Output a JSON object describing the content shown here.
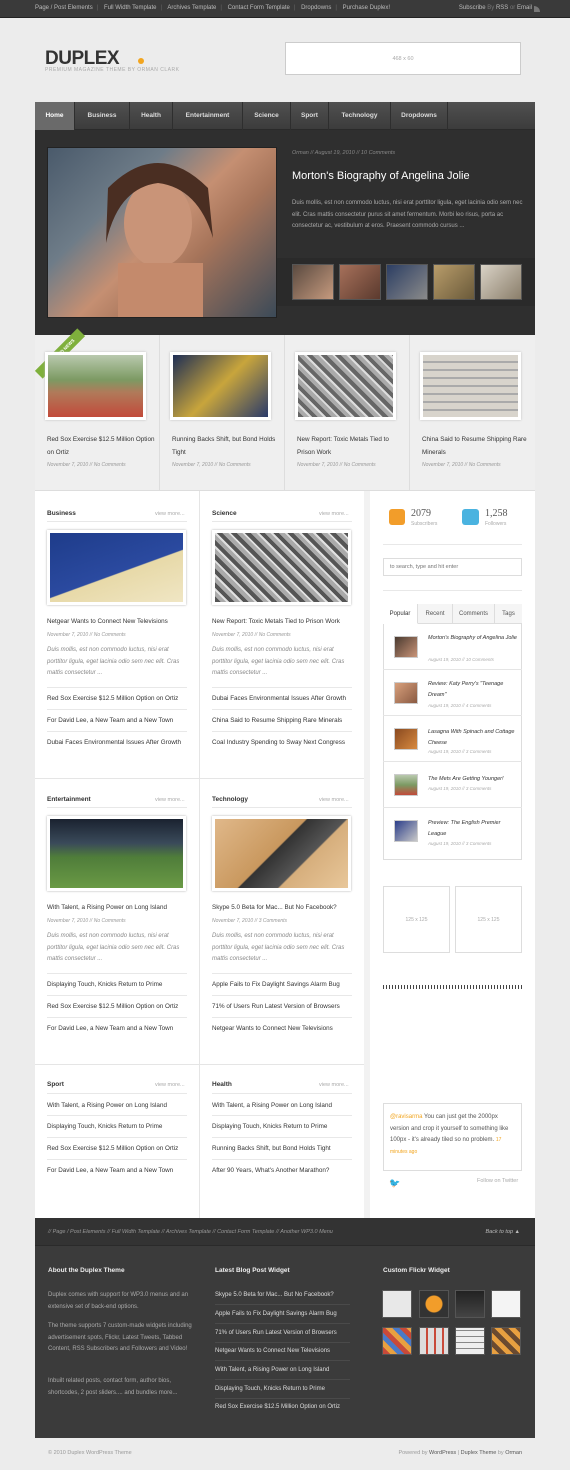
{
  "topbar": {
    "links": [
      "Page / Post Elements",
      "Full Width Template",
      "Archives Template",
      "Contact Form Template",
      "Dropdowns",
      "Purchase Duplex!"
    ],
    "subscribe": "Subscribe",
    "by": "By",
    "rss": "RSS",
    "or": "or",
    "email": "Email"
  },
  "header": {
    "logo": "DUPLEX",
    "tagline": "PREMIUM MAGAZINE THEME BY ORMAN CLARK",
    "ad": "468 x 60"
  },
  "nav": [
    "Home",
    "Business",
    "Health",
    "Entertainment",
    "Science",
    "Sport",
    "Technology",
    "Dropdowns"
  ],
  "feature": {
    "author": "Orman",
    "sep1": "//",
    "date": "August 19, 2010",
    "sep2": "//",
    "comments": "10 Comments",
    "title": "Morton's Biography of Angelina Jolie",
    "desc": "Duis mollis, est non commodo luctus, nisi erat porttitor ligula, eget lacinia odio sem nec elit. Cras mattis consectetur purus sit amet fermentum. Morbi leo risus, porta ac consectetur ac, vestibulum at eros. Praesent commodo cursus ..."
  },
  "ribbon": "FEATURED NEWS",
  "featured": [
    {
      "title": "Red Sox Exercise $12.5 Million Option on Ortiz",
      "date": "November 7, 2010",
      "comments": "No Comments"
    },
    {
      "title": "Running Backs Shift, but Bond Holds Tight",
      "date": "November 7, 2010",
      "comments": "No Comments"
    },
    {
      "title": "New Report: Toxic Metals Tied to Prison Work",
      "date": "November 7, 2010",
      "comments": "No Comments"
    },
    {
      "title": "China Said to Resume Shipping Rare Minerals",
      "date": "November 7, 2010",
      "comments": "No Comments"
    }
  ],
  "sep": "//",
  "viewmore": "view more...",
  "sections": {
    "business": {
      "head": "Business",
      "title": "Netgear Wants to Connect New Televisions",
      "date": "November 7, 2010",
      "comments": "No Comments",
      "excerpt": "Duis mollis, est non commodo luctus, nisi erat porttitor ligula, eget lacinia odio sem nec elit. Cras mattis consectetur ...",
      "links": [
        "Red Sox Exercise $12.5 Million Option on Ortiz",
        "For David Lee, a New Team and a New Town",
        "Dubai Faces Environmental Issues After Growth"
      ]
    },
    "science": {
      "head": "Science",
      "title": "New Report: Toxic Metals Tied to Prison Work",
      "date": "November 7, 2010",
      "comments": "No Comments",
      "excerpt": "Duis mollis, est non commodo luctus, nisi erat porttitor ligula, eget lacinia odio sem nec elit. Cras mattis consectetur ...",
      "links": [
        "Dubai Faces Environmental Issues After Growth",
        "China Said to Resume Shipping Rare Minerals",
        "Coal Industry Spending to Sway Next Congress"
      ]
    },
    "entertainment": {
      "head": "Entertainment",
      "title": "With Talent, a Rising Power on Long Island",
      "date": "November 7, 2010",
      "comments": "No Comments",
      "excerpt": "Duis mollis, est non commodo luctus, nisi erat porttitor ligula, eget lacinia odio sem nec elit. Cras mattis consectetur ...",
      "links": [
        "Displaying Touch, Knicks Return to Prime",
        "Red Sox Exercise $12.5 Million Option on Ortiz",
        "For David Lee, a New Team and a New Town"
      ]
    },
    "technology": {
      "head": "Technology",
      "title": "Skype 5.0 Beta for Mac... But No Facebook?",
      "date": "November 7, 2010",
      "comments": "3 Comments",
      "excerpt": "Duis mollis, est non commodo luctus, nisi erat porttitor ligula, eget lacinia odio sem nec elit. Cras mattis consectetur ...",
      "links": [
        "Apple Fails to Fix Daylight Savings Alarm Bug",
        "71% of Users Run Latest Version of Browsers",
        "Netgear Wants to Connect New Televisions"
      ]
    },
    "sport": {
      "head": "Sport",
      "links": [
        "With Talent, a Rising Power on Long Island",
        "Displaying Touch, Knicks Return to Prime",
        "Red Sox Exercise $12.5 Million Option on Ortiz",
        "For David Lee, a New Team and a New Town"
      ]
    },
    "health": {
      "head": "Health",
      "links": [
        "With Talent, a Rising Power on Long Island",
        "Displaying Touch, Knicks Return to Prime",
        "Running Backs Shift, but Bond Holds Tight",
        "After 90 Years, What's Another Marathon?"
      ]
    }
  },
  "sidebar": {
    "subscribers": {
      "count": "2079",
      "label": "Subscribers"
    },
    "followers": {
      "count": "1,258",
      "label": "Followers"
    },
    "search_placeholder": "to search, type and hit enter",
    "tabs": [
      "Popular",
      "Recent",
      "Comments",
      "Tags"
    ],
    "popular": [
      {
        "title": "Morton's Biography of Angelina Jolie",
        "date": "August 19, 2010",
        "comments": "10 Comments"
      },
      {
        "title": "Review: Katy Perry's \"Teenage Dream\"",
        "date": "August 19, 2010",
        "comments": "4 Comments"
      },
      {
        "title": "Lasagna With Spinach and Cottage Cheese",
        "date": "August 19, 2010",
        "comments": "3 Comments"
      },
      {
        "title": "The Mets Are Getting Younger!",
        "date": "August 19, 2010",
        "comments": "3 Comments"
      },
      {
        "title": "Preview: The English Premier League",
        "date": "August 19, 2010",
        "comments": "3 Comments"
      }
    ],
    "ad1": "125 x 125",
    "ad2": "125 x 125",
    "tweet": {
      "handle": "@ravisarma",
      "text": "You can just get the 2000px version and crop it yourself to something like 100px - it's already tiled so no problem.",
      "time": "17 minutes ago"
    },
    "follow": "Follow on Twitter"
  },
  "footer": {
    "links": [
      "Page / Post Elements",
      "Full Width Template",
      "Archives Template",
      "Contact Form Template",
      "Another WP3.0 Menu"
    ],
    "back": "Back to top",
    "about_head": "About the Duplex Theme",
    "about": [
      "Duplex comes with support for WP3.0 menus and an extensive set of back-end options.",
      "The theme supports 7 custom-made widgets including advertisement spots, Flickr, Latest Tweets, Tabbed Content, RSS Subscribers and Followers and Video!",
      "Inbuilt related posts, contact form, author bios, shortcodes, 2 post sliders.... and bundles more..."
    ],
    "latest_head": "Latest Blog Post Widget",
    "latest": [
      "Skype 5.0 Beta for Mac... But No Facebook?",
      "Apple Fails to Fix Daylight Savings Alarm Bug",
      "71% of Users Run Latest Version of Browsers",
      "Netgear Wants to Connect New Televisions",
      "With Talent, a Rising Power on Long Island",
      "Displaying Touch, Knicks Return to Prime",
      "Red Sox Exercise $12.5 Million Option on Ortiz"
    ],
    "flickr_head": "Custom Flickr Widget"
  },
  "copyright": {
    "left": "© 2010 Duplex WordPress Theme",
    "powered": "Powered by",
    "wp": "WordPress",
    "bar": "|",
    "theme": "Duplex Theme",
    "by": "by",
    "author": "Orman"
  },
  "colors": {
    "accent": "#f2a51f",
    "nav": "#444444",
    "green": "#7fb03c"
  }
}
